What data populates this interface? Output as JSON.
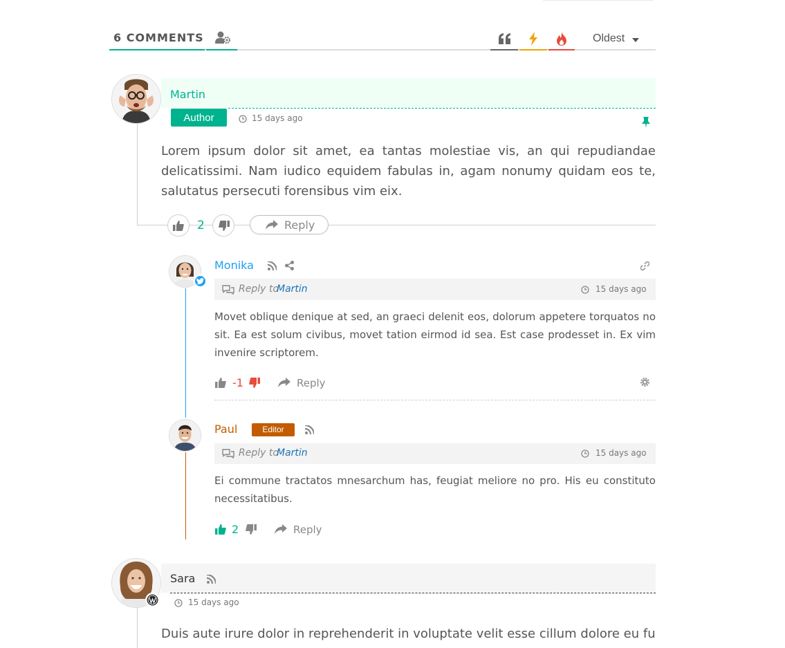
{
  "header": {
    "count_label": "6 COMMENTS",
    "sort_label": "Oldest"
  },
  "colors": {
    "accent": "#00b38f",
    "quote": "#666666",
    "hottest": "#f0a30a",
    "votes": "#e74c3c",
    "monika": "#1da1f2",
    "paul": "#c15c00",
    "negative": "#e74c3c",
    "positive": "#00b38f"
  },
  "comments": [
    {
      "author": "Martin",
      "role": "Author",
      "date": "15 days ago",
      "text": "Lorem ipsum dolor sit amet, ea tantas molestiae vis, an qui repudiandae delicatissimi. Nam iudico equidem fabulas in, agam nonumy quidam eos te, salutatus persecuti forensibus vim eix.",
      "votes": "2",
      "reply_label": "Reply",
      "badge_icon": "pin-icon"
    },
    {
      "author": "Monika",
      "reply_prefix": "Reply to",
      "reply_to": "Martin",
      "date": "15 days ago",
      "text": "Movet oblique denique at sed, an graeci delenit eos, dolorum appetere torquatos no sit. Ea est solum civibus, movet tation eirmod id sea. Est case prodesset in. Ex vim invenire scriptorem.",
      "votes": "-1",
      "reply_label": "Reply",
      "badge_icon": "twitter-icon"
    },
    {
      "author": "Paul",
      "role": "Editor",
      "reply_prefix": "Reply to",
      "reply_to": "Martin",
      "date": "15 days ago",
      "text": "Ei commune tractatos mnesarchum has, feugiat meliore no pro. His eu constituto necessitatibus.",
      "votes": "2",
      "reply_label": "Reply"
    },
    {
      "author": "Sara",
      "date": "15 days ago",
      "text": "Duis aute irure dolor in reprehenderit in voluptate velit esse cillum dolore eu fugiat",
      "badge_icon": "wordpress-icon"
    }
  ]
}
